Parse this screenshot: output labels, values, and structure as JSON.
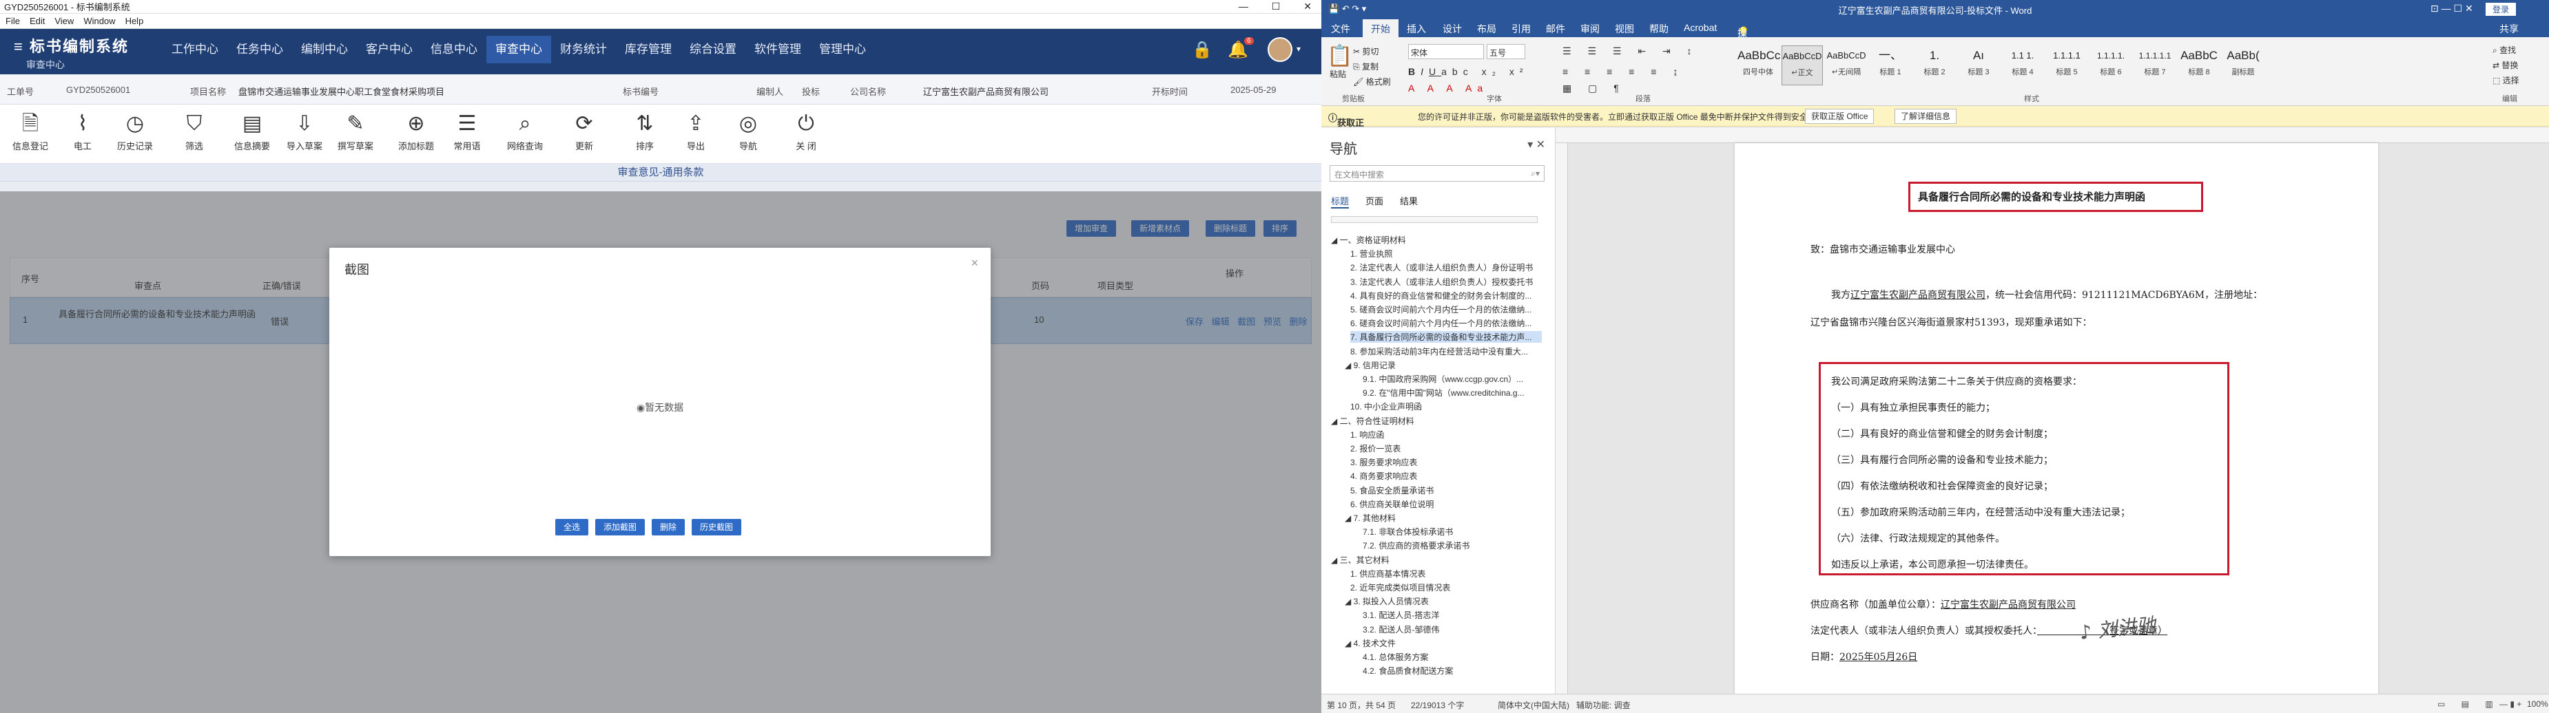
{
  "left": {
    "title": "GYD250526001 - 标书编制系统",
    "menu": [
      "File",
      "Edit",
      "View",
      "Window",
      "Help"
    ],
    "logo": "标书编制系统",
    "sub": "审查中心",
    "nav": [
      "工作中心",
      "任务中心",
      "编制中心",
      "客户中心",
      "信息中心",
      "审查中心",
      "财务统计",
      "库存管理",
      "综合设置",
      "软件管理",
      "管理中心"
    ],
    "badge": "6",
    "info": {
      "k1": "工单号",
      "v1": "GYD250526001",
      "k2": "项目名称",
      "v2": "盘锦市交通运输事业发展中心职工食堂食材采购项目",
      "k3": "标书编号",
      "k4": "编制人",
      "k5": "投标",
      "k6": "公司名称",
      "v6": "辽宁富生农副产品商贸有限公司",
      "k7": "开标时间",
      "v7": "2025-05-29"
    },
    "tools": [
      "信息登记",
      "电工",
      "历史记录",
      "筛选",
      "信息摘要",
      "导入草案",
      "撰写草案",
      "添加标题",
      "常用语",
      "网络查询",
      "更新",
      "排序",
      "导出",
      "导航",
      "关 闭"
    ],
    "section_title": "审查意见-通用条款",
    "buttons": [
      "增加审查",
      "新增素材点",
      "删除标题",
      "排序"
    ],
    "table_head": {
      "c1": "序号",
      "c2": "审查点",
      "c3": "正确/错误",
      "c4": "页码",
      "c5": "项目类型",
      "c6": "操作"
    },
    "row": {
      "num": "1",
      "point": "具备履行合同所必需的设备和专业技术能力声明函",
      "status": "错误",
      "page": "10",
      "ops": "保存 编辑 截图 预览 删除"
    },
    "modal": {
      "title": "截图",
      "close": "×",
      "empty": "暂无数据",
      "buttons": [
        "全选",
        "添加截图",
        "删除",
        "历史截图"
      ]
    }
  },
  "word": {
    "title": "辽宁富生农副产品商贸有限公司-投标文件 - Word",
    "login": "登录",
    "tabs": [
      "文件",
      "开始",
      "插入",
      "设计",
      "布局",
      "引用",
      "邮件",
      "审阅",
      "视图",
      "帮助",
      "Acrobat",
      "操作说明搜索"
    ],
    "share": "共享",
    "ribbon": {
      "paste": "粘贴",
      "cut": "剪切",
      "copy": "复制",
      "format_painter": "格式刷",
      "font_name": "宋体",
      "font_size": "五号",
      "groups": [
        "剪贴板",
        "字体",
        "段落",
        "样式",
        "编辑"
      ],
      "find": "查找",
      "replace": "替换",
      "select": "选择",
      "styles": [
        {
          "s": "AaBbCc",
          "n": "四号中体"
        },
        {
          "s": "AaBbCcD",
          "n": "↵正文"
        },
        {
          "s": "AaBbCcD",
          "n": "↵无间隔"
        },
        {
          "s": "一、",
          "n": "标题 1"
        },
        {
          "s": "1.",
          "n": "标题 2"
        },
        {
          "s": "Aı",
          "n": "标题 3"
        },
        {
          "s": "1.1 1.",
          "n": "标题 4"
        },
        {
          "s": "1.1.1.1",
          "n": "标题 5"
        },
        {
          "s": "1.1.1.1.",
          "n": "标题 6"
        },
        {
          "s": "1.1.1.1.1",
          "n": "标题 7"
        },
        {
          "s": "AaBbC",
          "n": "标题 8"
        },
        {
          "s": "AaBb(",
          "n": "副标题"
        }
      ]
    },
    "msg": {
      "label": "获取正版 OFFICE",
      "text": "您的许可证并非正版，你可能是盗版软件的受害者。立即通过获取正版 Office 最免中断并保护文件得到安全。",
      "b1": "获取正版 Office",
      "b2": "了解详细信息"
    },
    "nav": {
      "title": "导航",
      "search": "在文档中搜索",
      "tabs": [
        "标题",
        "页面",
        "结果"
      ],
      "items": [
        "◢ 一、资格证明材料",
        "1. 营业执照",
        "2. 法定代表人（或非法人组织负责人）身份证明书",
        "3. 法定代表人（或非法人组织负责人）授权委托书",
        "4. 具有良好的商业信誉和健全的财务会计制度的...",
        "5. 磋商会议时间前六个月内任一个月的依法缴纳...",
        "6. 磋商会议时间前六个月内任一个月的依法缴纳...",
        "7. 具备履行合同所必需的设备和专业技术能力声...",
        "8. 参加采购活动前3年内在经营活动中没有重大...",
        "◢ 9. 信用记录",
        "9.1. 中国政府采购网（www.ccgp.gov.cn）...",
        "9.2. 在\"信用中国\"网站（www.creditchina.g...",
        "10. 中小企业声明函",
        "◢ 二、符合性证明材料",
        "1. 响应函",
        "2. 报价一览表",
        "3. 服务要求响应表",
        "4. 商务要求响应表",
        "5. 食品安全质量承诺书",
        "6. 供应商关联单位说明",
        "◢ 7. 其他材料",
        "7.1. 非联合体投标承诺书",
        "7.2. 供应商的资格要求承诺书",
        "◢ 三、其它材料",
        "1. 供应商基本情况表",
        "2. 近年完成类似项目情况表",
        "◢ 3. 拟投入人员情况表",
        "3.1. 配送人员-搭志洋",
        "3.2. 配送人员-邹德伟",
        "◢ 4. 技术文件",
        "4.1. 总体服务方案",
        "4.2. 食品质食材配送方案"
      ]
    },
    "page": {
      "heading": "具备履行合同所必需的设备和专业技术能力声明函",
      "to": "致：盘锦市交通运输事业发展中心",
      "p1a": "我方",
      "p1company": "辽宁富生农副产品商贸有限公司",
      "p1b": "，统一社会信用代码：91211121MACD6BYA6M，注册地址：",
      "p2": "辽宁省盘锦市兴隆台区兴海街道景家村51393，现郑重承诺如下：",
      "req_title": "我公司满足政府采购法第二十二条关于供应商的资格要求：",
      "reqs": [
        "（一）具有独立承担民事责任的能力；",
        "（二）具有良好的商业信誉和健全的财务会计制度；",
        "（三）具有履行合同所必需的设备和专业技术能力；",
        "（四）有依法缴纳税收和社会保障资金的良好记录；",
        "（五）参加政府采购活动前三年内，在经营活动中没有重大违法记录；",
        "（六）法律、行政法规规定的其他条件。"
      ],
      "promise": "如违反以上承诺，本公司愿承担一切法律责任。",
      "sup_label": "供应商名称（加盖单位公章）：",
      "sup_name": "辽宁富生农副产品商贸有限公司",
      "rep_label": "法定代表人（或非法人组织负责人）或其授权委托人：",
      "rep_sign": "（签字或盖章）",
      "date_label": "日期：",
      "date": "2025年05月26日"
    },
    "status": {
      "page": "第 10 页，共 54 页",
      "words": "22/19013 个字",
      "lang": "简体中文(中国大陆)",
      "access": "辅助功能: 调查",
      "zoom": "100%"
    }
  }
}
